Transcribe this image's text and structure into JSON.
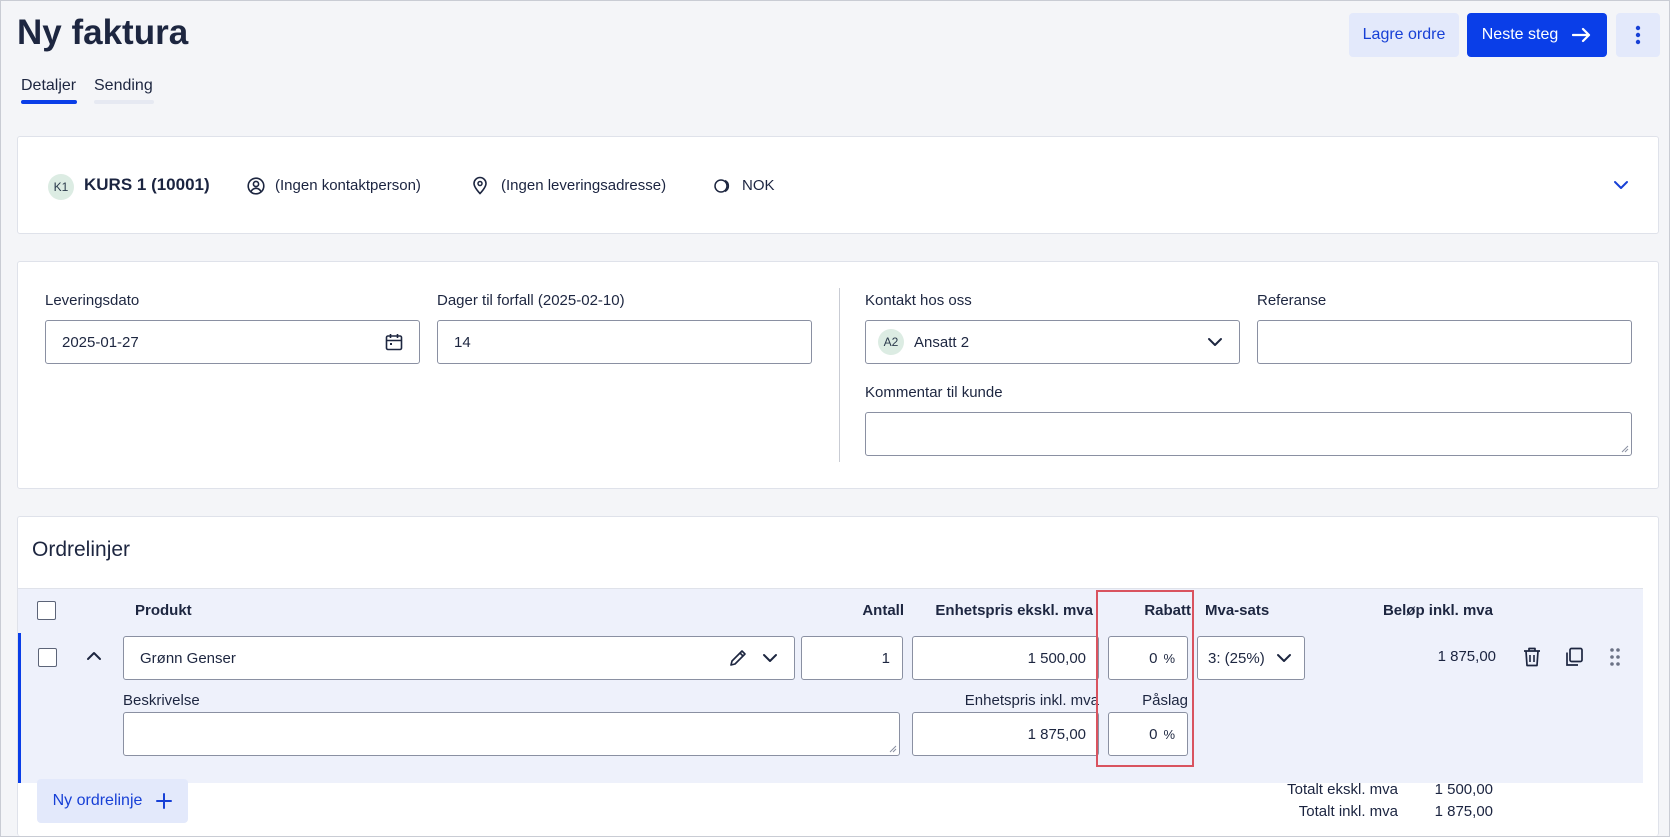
{
  "header": {
    "title": "Ny faktura",
    "save_order": "Lagre ordre",
    "next_step": "Neste steg"
  },
  "tabs": [
    {
      "label": "Detaljer",
      "active": true
    },
    {
      "label": "Sending",
      "active": false
    }
  ],
  "customer": {
    "initials": "K1",
    "name": "KURS 1 (10001)",
    "contact": "(Ingen kontaktperson)",
    "delivery_address": "(Ingen leveringsadresse)",
    "currency": "NOK"
  },
  "details": {
    "delivery_date_label": "Leveringsdato",
    "delivery_date_value": "2025-01-27",
    "due_days_label": "Dager til forfall (2025-02-10)",
    "due_days_value": "14",
    "our_contact_label": "Kontakt hos oss",
    "our_contact_initials": "A2",
    "our_contact_value": "Ansatt 2",
    "reference_label": "Referanse",
    "reference_value": "",
    "comment_label": "Kommentar til kunde",
    "comment_value": ""
  },
  "order_lines": {
    "title": "Ordrelinjer",
    "columns": {
      "product": "Produkt",
      "quantity": "Antall",
      "unit_price_excl": "Enhetspris ekskl. mva",
      "discount": "Rabatt",
      "vat_rate": "Mva-sats",
      "amount_incl": "Beløp inkl. mva"
    },
    "rows": [
      {
        "product": "Grønn Genser",
        "quantity": "1",
        "unit_price_excl": "1 500,00",
        "discount": "0",
        "discount_unit": "%",
        "vat_rate": "3: (25%)",
        "amount_incl": "1 875,00",
        "description_label": "Beskrivelse",
        "description_value": "",
        "unit_price_incl_label": "Enhetspris inkl. mva",
        "unit_price_incl": "1 875,00",
        "markup_label": "Påslag",
        "markup": "0",
        "markup_unit": "%"
      }
    ],
    "new_line": "Ny ordrelinje",
    "total_excl_label": "Totalt ekskl. mva",
    "total_excl_value": "1 500,00",
    "total_incl_label": "Totalt inkl. mva",
    "total_incl_value": "1 875,00"
  },
  "colors": {
    "primary": "#0a3ee8",
    "secondary_bg": "#e3e9fb",
    "highlight": "#d9535f",
    "row_bg": "#eef1fb"
  }
}
